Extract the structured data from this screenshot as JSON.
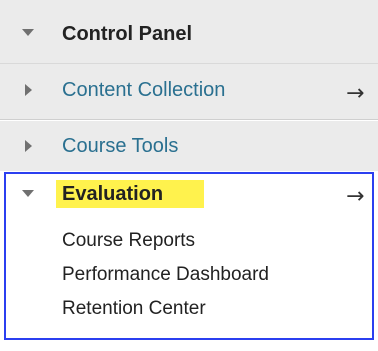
{
  "menu": {
    "control_panel": {
      "label": "Control Panel",
      "icon": "triangle-down-icon"
    },
    "content_collection": {
      "label": "Content Collection",
      "icon": "triangle-right-icon",
      "arrow": "→"
    },
    "course_tools": {
      "label": "Course Tools",
      "icon": "triangle-right-icon"
    },
    "evaluation": {
      "label": "Evaluation",
      "icon": "triangle-down-icon",
      "arrow": "→",
      "highlight_color": "#fff24d",
      "border_color": "#2b3ff0",
      "items": [
        {
          "label": "Course Reports"
        },
        {
          "label": "Performance Dashboard"
        },
        {
          "label": "Retention Center"
        }
      ]
    }
  },
  "colors": {
    "header_bg": "#ebebeb",
    "link": "#2a7090",
    "text": "#222222"
  }
}
